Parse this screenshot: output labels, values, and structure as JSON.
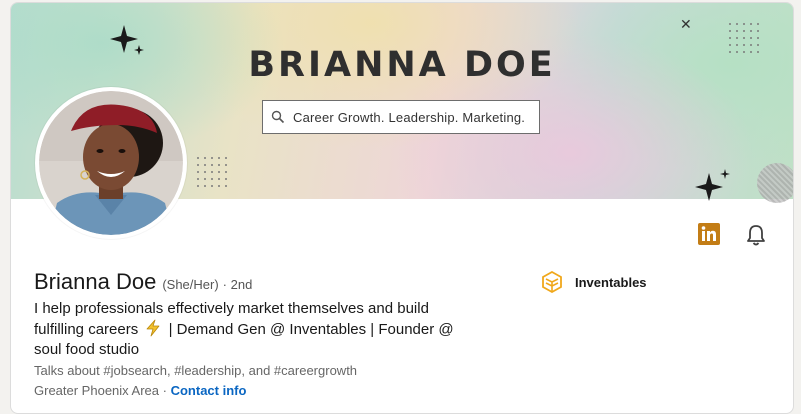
{
  "banner": {
    "title": "BRIANNA DOE",
    "search_text": "Career Growth. Leadership. Marketing."
  },
  "profile": {
    "name": "Brianna Doe",
    "pronouns": "(She/Her)",
    "degree": "· 2nd",
    "headline_part1": "I help professionals effectively market themselves and build fulfilling careers",
    "headline_part2": "| Demand Gen @ Inventables | Founder @ soul food studio",
    "talks_about": "Talks about #jobsearch, #leadership, and #careergrowth",
    "location": "Greater Phoenix Area",
    "separator": " · ",
    "contact_info_label": "Contact info"
  },
  "company": {
    "name": "Inventables",
    "logo_color": "#f0a81c"
  },
  "actions": {
    "linkedin_icon": "linkedin-icon",
    "bell_icon": "bell-icon",
    "linkedin_color": "#c37d16"
  },
  "colors": {
    "link": "#0a66c2",
    "text": "#191919",
    "muted": "#666666"
  }
}
